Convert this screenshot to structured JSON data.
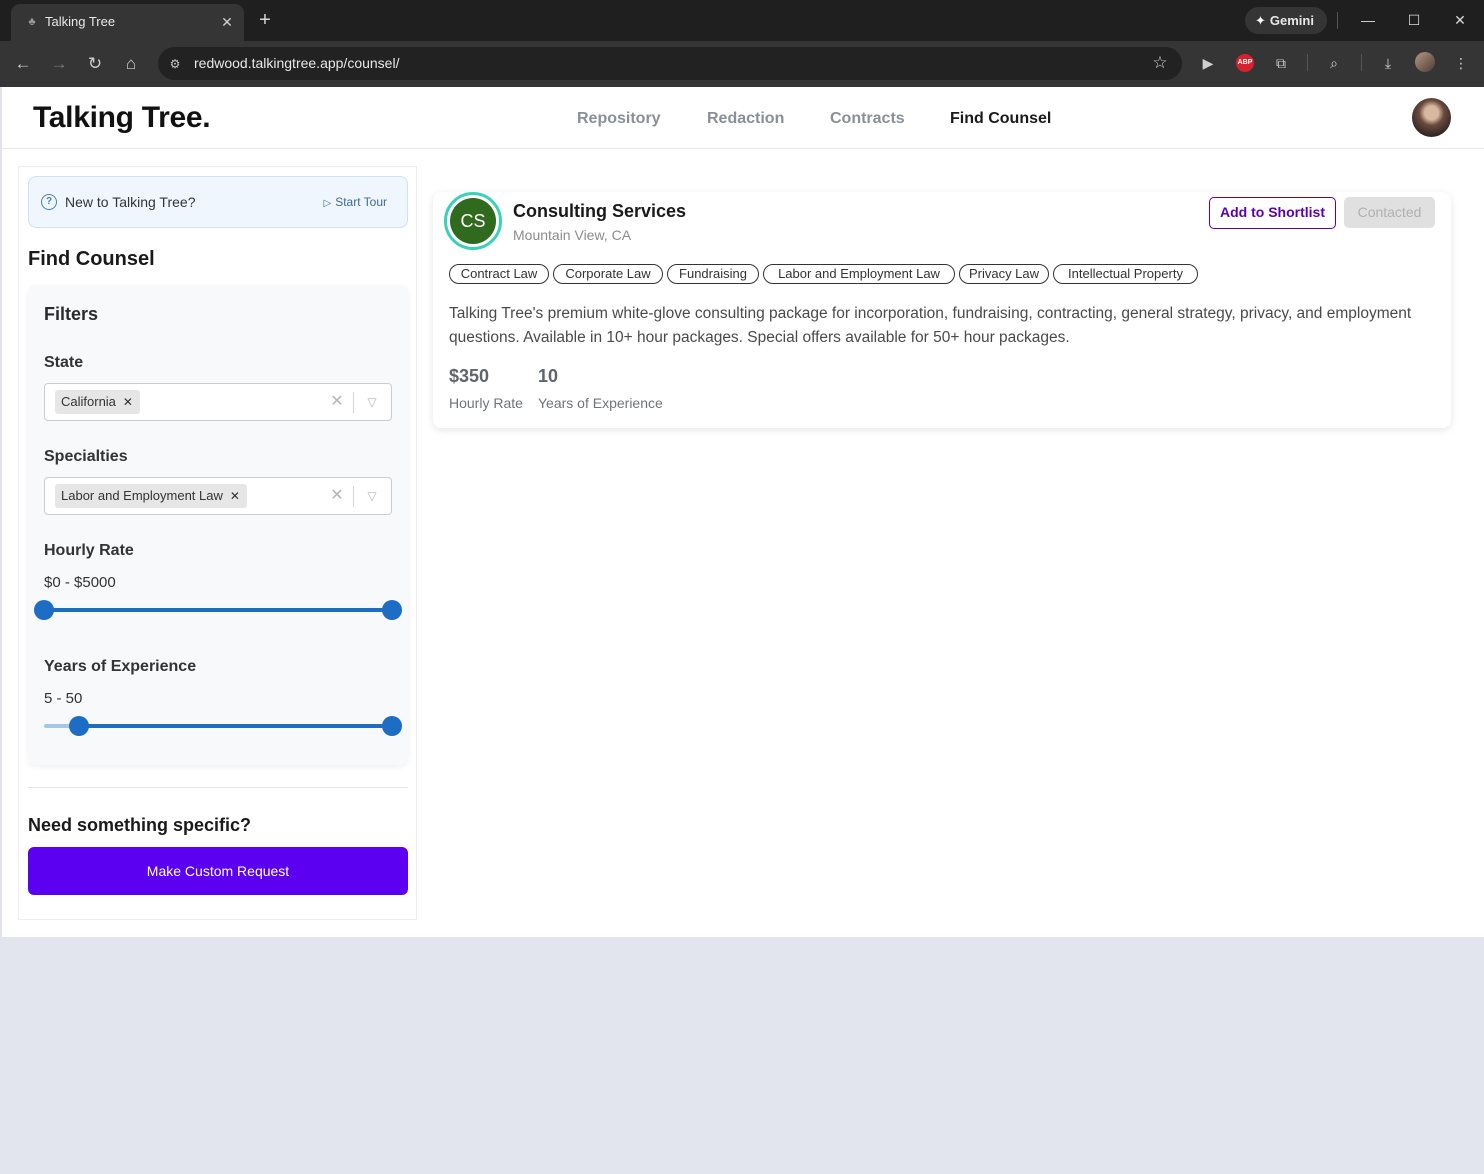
{
  "browser": {
    "tab_title": "Talking Tree",
    "url": "redwood.talkingtree.app/counsel/",
    "gemini_label": "Gemini"
  },
  "header": {
    "brand": "Talking Tree.",
    "nav": [
      {
        "label": "Repository",
        "active": false
      },
      {
        "label": "Redaction",
        "active": false
      },
      {
        "label": "Contracts",
        "active": false
      },
      {
        "label": "Find Counsel",
        "active": true
      }
    ]
  },
  "sidebar": {
    "tour_prompt": "New to Talking Tree?",
    "tour_link": "Start Tour",
    "title": "Find Counsel",
    "filters": {
      "heading": "Filters",
      "state": {
        "label": "State",
        "selected": [
          "California"
        ]
      },
      "specialties": {
        "label": "Specialties",
        "selected": [
          "Labor and Employment Law"
        ]
      },
      "hourly_rate": {
        "label": "Hourly Rate",
        "value_text": "$0 - $5000",
        "min": 0,
        "max": 5000,
        "low": 0,
        "high": 5000
      },
      "experience": {
        "label": "Years of Experience",
        "value_text": "5 - 50",
        "min": 0,
        "max": 50,
        "low": 5,
        "high": 50
      }
    },
    "custom": {
      "title": "Need something specific?",
      "button": "Make Custom Request"
    }
  },
  "results": [
    {
      "initials": "CS",
      "name": "Consulting Services",
      "location": "Mountain View, CA",
      "shortlist_label": "Add to Shortlist",
      "contacted_label": "Contacted",
      "tags": [
        "Contract Law",
        "Corporate Law",
        "Fundraising",
        "Labor and Employment Law",
        "Privacy Law",
        "Intellectual Property"
      ],
      "description": "Talking Tree's premium white-glove consulting package for incorporation, fundraising, contracting, general strategy, privacy, and employment questions. Available in 10+ hour packages. Special offers available for 50+ hour packages.",
      "rate_value": "$350",
      "rate_label": "Hourly Rate",
      "experience_value": "10",
      "experience_label": "Years of Experience"
    }
  ],
  "colors": {
    "accent": "#5b00f0",
    "slider": "#1d6dc4",
    "avatar_ring": "#3bd1b8",
    "avatar_bg": "#2f6a1f"
  }
}
